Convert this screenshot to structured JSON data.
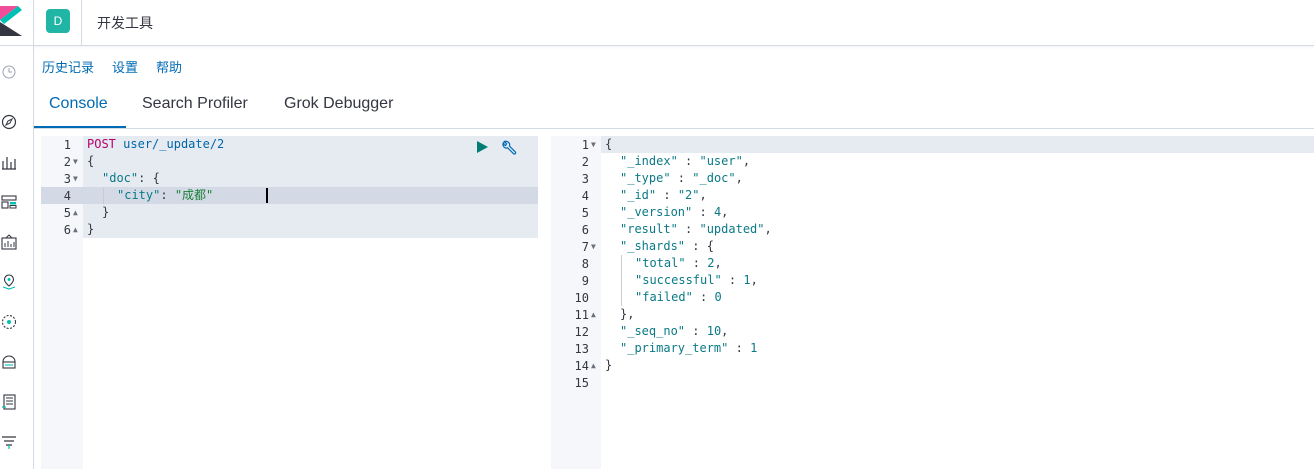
{
  "header": {
    "space_initial": "D",
    "app_title": "开发工具"
  },
  "menu": {
    "history": "历史记录",
    "settings": "设置",
    "help": "帮助"
  },
  "tabs": [
    {
      "label": "Console",
      "active": true
    },
    {
      "label": "Search Profiler",
      "active": false
    },
    {
      "label": "Grok Debugger",
      "active": false
    }
  ],
  "request": {
    "line_numbers": [
      "1",
      "2",
      "3",
      "4",
      "5",
      "6"
    ],
    "lines": {
      "l1_method": "POST",
      "l1_path": "user/_update/2",
      "l2": "{",
      "l3_key": "\"doc\"",
      "l3_rest": ": {",
      "l4_key": "\"city\"",
      "l4_colon": ": ",
      "l4_value": "\"成都\"",
      "l5": "}",
      "l6": "}"
    }
  },
  "response": {
    "line_numbers": [
      "1",
      "2",
      "3",
      "4",
      "5",
      "6",
      "7",
      "8",
      "9",
      "10",
      "11",
      "12",
      "13",
      "14",
      "15"
    ],
    "lines": {
      "l1": "{",
      "l2_key": "\"_index\"",
      "l2_val": "\"user\"",
      "l3_key": "\"_type\"",
      "l3_val": "\"_doc\"",
      "l4_key": "\"_id\"",
      "l4_val": "\"2\"",
      "l5_key": "\"_version\"",
      "l5_val": "4",
      "l6_key": "\"result\"",
      "l6_val": "\"updated\"",
      "l7_key": "\"_shards\"",
      "l7_rest": " : {",
      "l8_key": "\"total\"",
      "l8_val": "2",
      "l9_key": "\"successful\"",
      "l9_val": "1",
      "l10_key": "\"failed\"",
      "l10_val": "0",
      "l11": "},",
      "l12_key": "\"_seq_no\"",
      "l12_val": "10",
      "l13_key": "\"_primary_term\"",
      "l13_val": "1",
      "l14": "}"
    }
  },
  "colors": {
    "accent": "#006bb4",
    "space_avatar": "#20b5a5",
    "run_button": "#017d73"
  },
  "icons": [
    "elastic-logo-icon",
    "recent-clock-icon",
    "discover-compass-icon",
    "visualize-chart-icon",
    "dashboard-icon",
    "canvas-icon",
    "maps-icon",
    "ml-icon",
    "infrastructure-icon",
    "logs-icon",
    "apm-icon",
    "play-icon",
    "wrench-icon"
  ]
}
